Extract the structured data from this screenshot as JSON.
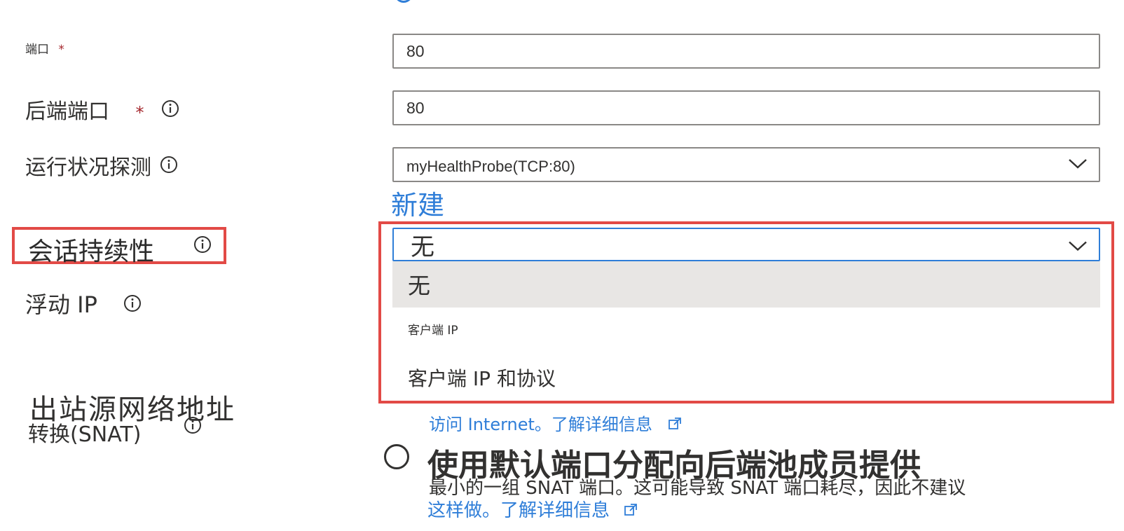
{
  "fields": {
    "port": {
      "label": "端口",
      "required": "*",
      "value": "80"
    },
    "backend_port": {
      "label": "后端端口",
      "required": "*",
      "value": "80"
    },
    "health_probe": {
      "label": "运行状况探测",
      "value": "myHealthProbe(TCP:80)",
      "create_new": "新建"
    },
    "session_persistence": {
      "label": "会话持续性",
      "value": "无",
      "options": [
        "无",
        "客户端 IP",
        "客户端 IP 和协议"
      ],
      "highlighted_index": 0
    },
    "floating_ip": {
      "label": "浮动 IP"
    },
    "snat": {
      "label_line1": "出站源网络地址",
      "label_line2": "转换(SNAT)",
      "option1_partial": "访问 Internet。了解详细信息",
      "option2_title": "使用默认端口分配向后端池成员提供",
      "option2_desc": "最小的一组 SNAT 端口。这可能导致 SNAT 端口耗尽，因此不建议",
      "option2_link": "这样做。了解详细信息"
    }
  },
  "colors": {
    "accent": "#2f7ed8",
    "highlight_border": "#e24a46",
    "required": "#a4262c",
    "option_hover": "#e8e6e4"
  }
}
